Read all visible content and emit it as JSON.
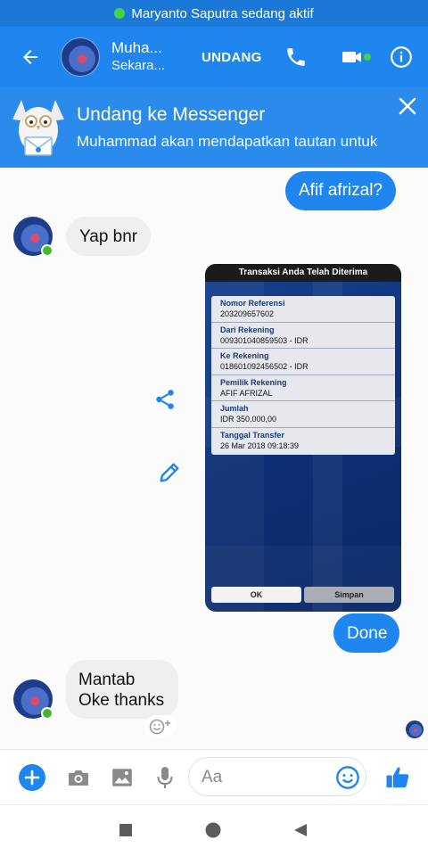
{
  "status_bar": {
    "text": "Maryanto Saputra sedang aktif"
  },
  "header": {
    "name": "Muha...",
    "sub": "Sekara...",
    "invite_label": "UNDANG",
    "icons": [
      "back-arrow-icon",
      "phone-icon",
      "video-camera-icon",
      "info-icon"
    ]
  },
  "banner": {
    "title": "Undang ke Messenger",
    "subtitle": "Muhammad akan mendapatkan tautan untuk"
  },
  "messages": {
    "m1": "Afif afrizal?",
    "m2": "Yap bnr",
    "m3": "Done",
    "m4_line1": "Mantab",
    "m4_line2": "Oke thanks"
  },
  "receipt": {
    "title": "Transaksi Anda Telah Diterima",
    "rows": [
      {
        "label": "Nomor Referensi",
        "value": "203209657602"
      },
      {
        "label": "Dari Rekening",
        "value": "009301040859503 - IDR"
      },
      {
        "label": "Ke Rekening",
        "value": "018601092456502 - IDR"
      },
      {
        "label": "Pemilik Rekening",
        "value": "AFIF AFRIZAL"
      },
      {
        "label": "Jumlah",
        "value": "IDR 350.000,00"
      },
      {
        "label": "Tanggal Transfer",
        "value": "26 Mar 2018 09:18:39"
      }
    ],
    "ok_label": "OK",
    "save_label": "Simpan"
  },
  "composer": {
    "placeholder": "Aa"
  },
  "colors": {
    "messenger_blue": "#1f85ef",
    "status_bar": "#1b78d6",
    "online_green": "#42b72a"
  }
}
